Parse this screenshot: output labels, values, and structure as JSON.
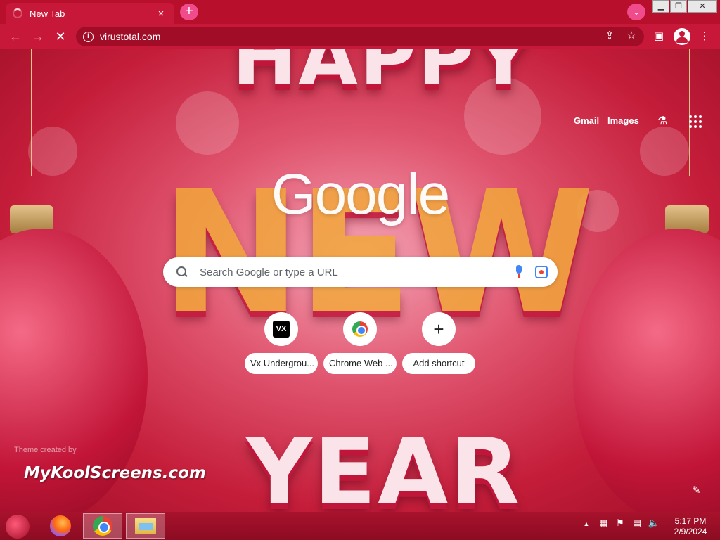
{
  "browser": {
    "tab": {
      "title": "New Tab",
      "close_glyph": "×"
    },
    "new_tab_glyph": "+",
    "tab_search_glyph": "⌄",
    "window_controls": {
      "minimize": "▁",
      "restore": "❐",
      "close": "✕"
    },
    "toolbar": {
      "back_glyph": "←",
      "forward_glyph": "→",
      "stop_glyph": "✕",
      "url": "virustotal.com",
      "share_glyph": "⇪",
      "bookmark_glyph": "☆",
      "side_panel_glyph": "▣",
      "menu_glyph": "⋮"
    }
  },
  "ntp": {
    "logo": "Google",
    "top_links": {
      "gmail": "Gmail",
      "images": "Images"
    },
    "labs_glyph": "⚗",
    "search_placeholder": "Search Google or type a URL",
    "shortcuts": [
      {
        "label": "Vx Undergrou...",
        "badge": "VX"
      },
      {
        "label": "Chrome Web ...",
        "badge": ""
      },
      {
        "label": "Add shortcut",
        "badge": "+"
      }
    ],
    "theme_credit": "Theme created by",
    "theme_author": "MyKoolScreens.com",
    "customize_glyph": "✎",
    "background_words": {
      "w1": "HAPPY",
      "w2": "NEW",
      "w3": "YEAR"
    }
  },
  "taskbar": {
    "tray": {
      "show_hidden": "▲",
      "flag": "⚑",
      "network": "▤",
      "volume": "🔈"
    },
    "clock": {
      "time": "5:17 PM",
      "date": "2/9/2024"
    }
  }
}
